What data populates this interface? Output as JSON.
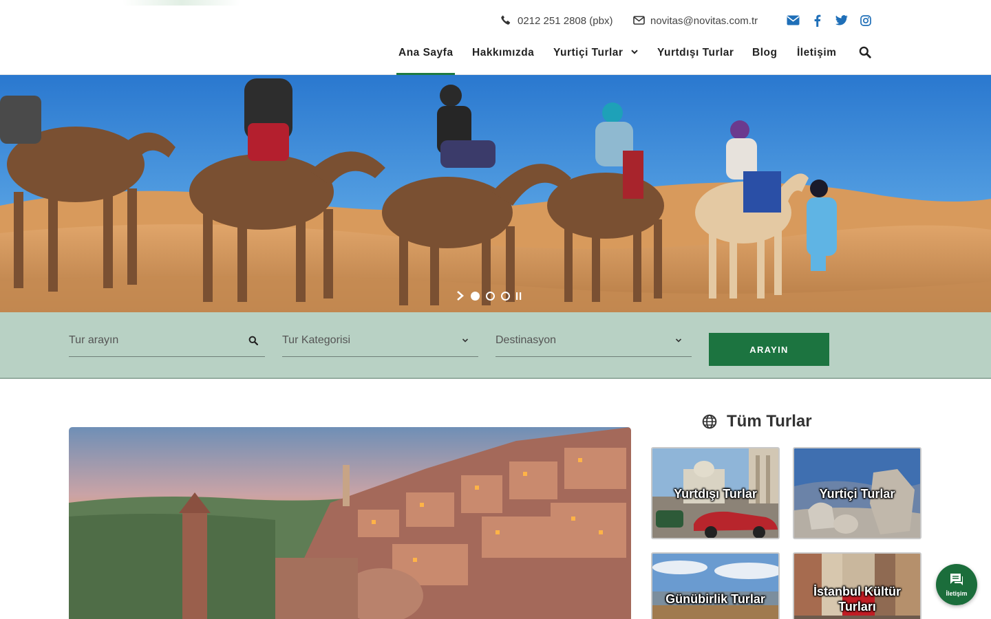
{
  "header": {
    "phone": "0212 251 2808 (pbx)",
    "email": "novitas@novitas.com.tr",
    "social": [
      "envelope-icon",
      "facebook-icon",
      "twitter-icon",
      "instagram-icon"
    ],
    "nav": [
      {
        "label": "Ana Sayfa",
        "active": true
      },
      {
        "label": "Hakkımızda"
      },
      {
        "label": "Yurtiçi Turlar",
        "has_dropdown": true
      },
      {
        "label": "Yurtdışı Turlar"
      },
      {
        "label": "Blog"
      },
      {
        "label": "İletişim"
      }
    ]
  },
  "hero": {
    "slides": 3,
    "active_slide": 1
  },
  "search": {
    "tour_placeholder": "Tur arayın",
    "category_label": "Tur Kategorisi",
    "destination_label": "Destinasyon",
    "button_label": "ARAYIN"
  },
  "sidebar": {
    "title": "Tüm Turlar",
    "tiles": [
      {
        "label": "Yurtdışı Turlar"
      },
      {
        "label": "Yurtiçi Turlar"
      },
      {
        "label": "Günübirlik Turlar"
      },
      {
        "label_line1": "İstanbul Kültür",
        "label_line2": "Turları"
      }
    ]
  },
  "chat_button": {
    "label": "İletişim"
  },
  "colors": {
    "brand_green": "#1c7440",
    "search_band": "#b8d1c4",
    "sky": "#3b8fd6",
    "sand": "#d9a468"
  }
}
